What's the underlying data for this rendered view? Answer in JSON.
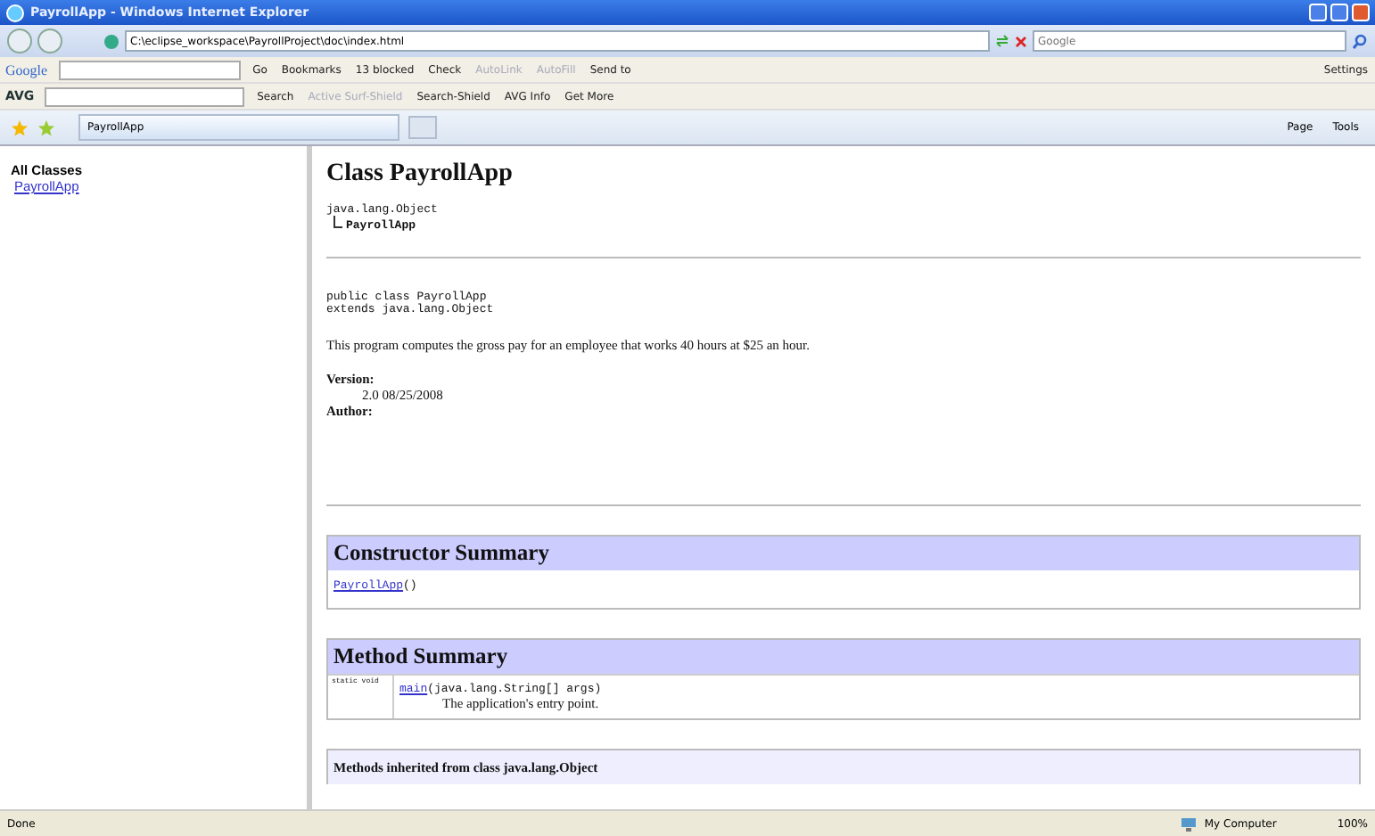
{
  "window": {
    "title": "PayrollApp - Windows Internet Explorer"
  },
  "address_bar": {
    "value": "C:\\eclipse_workspace\\PayrollProject\\doc\\index.html",
    "search_placeholder": "Google"
  },
  "google_toolbar": {
    "logo": "Google",
    "items": [
      {
        "label": "Go",
        "disabled": false
      },
      {
        "label": "Bookmarks",
        "disabled": false
      },
      {
        "label": "13 blocked",
        "disabled": false
      },
      {
        "label": "Check",
        "disabled": false
      },
      {
        "label": "AutoLink",
        "disabled": true
      },
      {
        "label": "AutoFill",
        "disabled": true
      },
      {
        "label": "Send to",
        "disabled": false
      }
    ],
    "settings": "Settings"
  },
  "avg_toolbar": {
    "logo": "AVG",
    "items": [
      {
        "label": "Search",
        "disabled": false
      },
      {
        "label": "Active Surf-Shield",
        "disabled": true
      },
      {
        "label": "Search-Shield",
        "disabled": false
      },
      {
        "label": "AVG Info",
        "disabled": false
      },
      {
        "label": "Get More",
        "disabled": false
      }
    ]
  },
  "tabs": [
    {
      "label": "PayrollApp",
      "selected": true
    }
  ],
  "command_bar": [
    "Page",
    "Tools"
  ],
  "left_frame": {
    "heading": "All Classes",
    "links": [
      "PayrollApp"
    ]
  },
  "doc": {
    "title": "Class PayrollApp",
    "hierarchy": [
      "java.lang.Object",
      "PayrollApp"
    ],
    "declaration": [
      "public class PayrollApp",
      "extends java.lang.Object"
    ],
    "description": "This program computes the gross pay for an employee that works 40 hours at $25 an hour.",
    "tags": [
      {
        "label": "Version:",
        "value": "2.0 08/25/2008"
      },
      {
        "label": "Author:"
      }
    ],
    "constructor_summary": {
      "title": "Constructor Summary",
      "rows": [
        {
          "link": "PayrollApp",
          "signature": "()"
        }
      ]
    },
    "method_summary": {
      "title": "Method Summary",
      "rows": [
        {
          "modifier": "static void",
          "link": "main",
          "signature": "(java.lang.String[] args)",
          "description": "The application's entry point."
        }
      ]
    },
    "inherited": "Methods inherited from class java.lang.Object"
  },
  "status_bar": {
    "text": "Done",
    "zone": "My Computer",
    "zoom": "100%"
  }
}
